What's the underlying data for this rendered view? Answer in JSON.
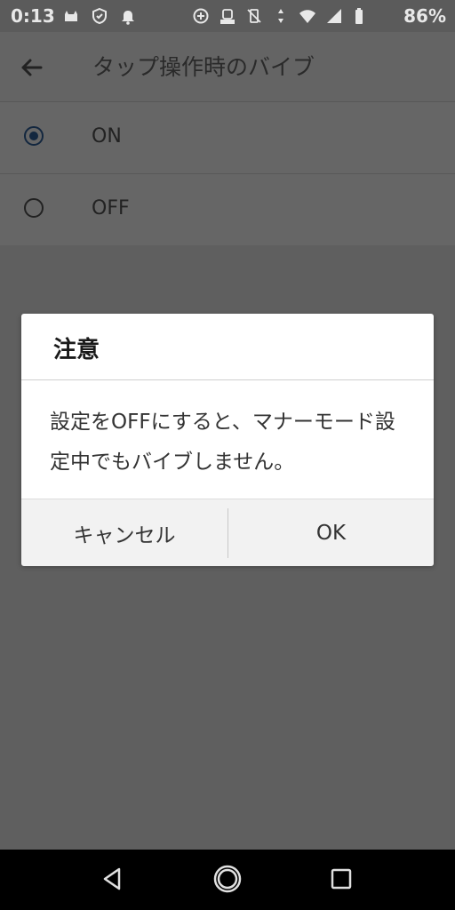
{
  "status_bar": {
    "time": "0:13",
    "battery_percent": "86%",
    "icons_left": [
      "cat-notification-icon",
      "shield-icon",
      "bell-icon"
    ],
    "icons_right": [
      "add-circle-icon",
      "lock-app-icon",
      "vibrate-off-icon",
      "data-arrows-icon",
      "wifi-icon",
      "signal-icon",
      "battery-icon"
    ]
  },
  "app_bar": {
    "title": "タップ操作時のバイブ"
  },
  "options": [
    {
      "label": "ON",
      "selected": true
    },
    {
      "label": "OFF",
      "selected": false
    }
  ],
  "dialog": {
    "title": "注意",
    "message": "設定をOFFにすると、マナーモード設定中でもバイブしません。",
    "cancel_label": "キャンセル",
    "ok_label": "OK"
  },
  "nav_bar": {
    "icons": [
      "back-triangle-icon",
      "home-circle-icon",
      "recents-square-icon"
    ]
  },
  "colors": {
    "scrim": "#5f5f5f",
    "dialog_bg": "#ffffff",
    "radio_selected": "#13273f"
  }
}
